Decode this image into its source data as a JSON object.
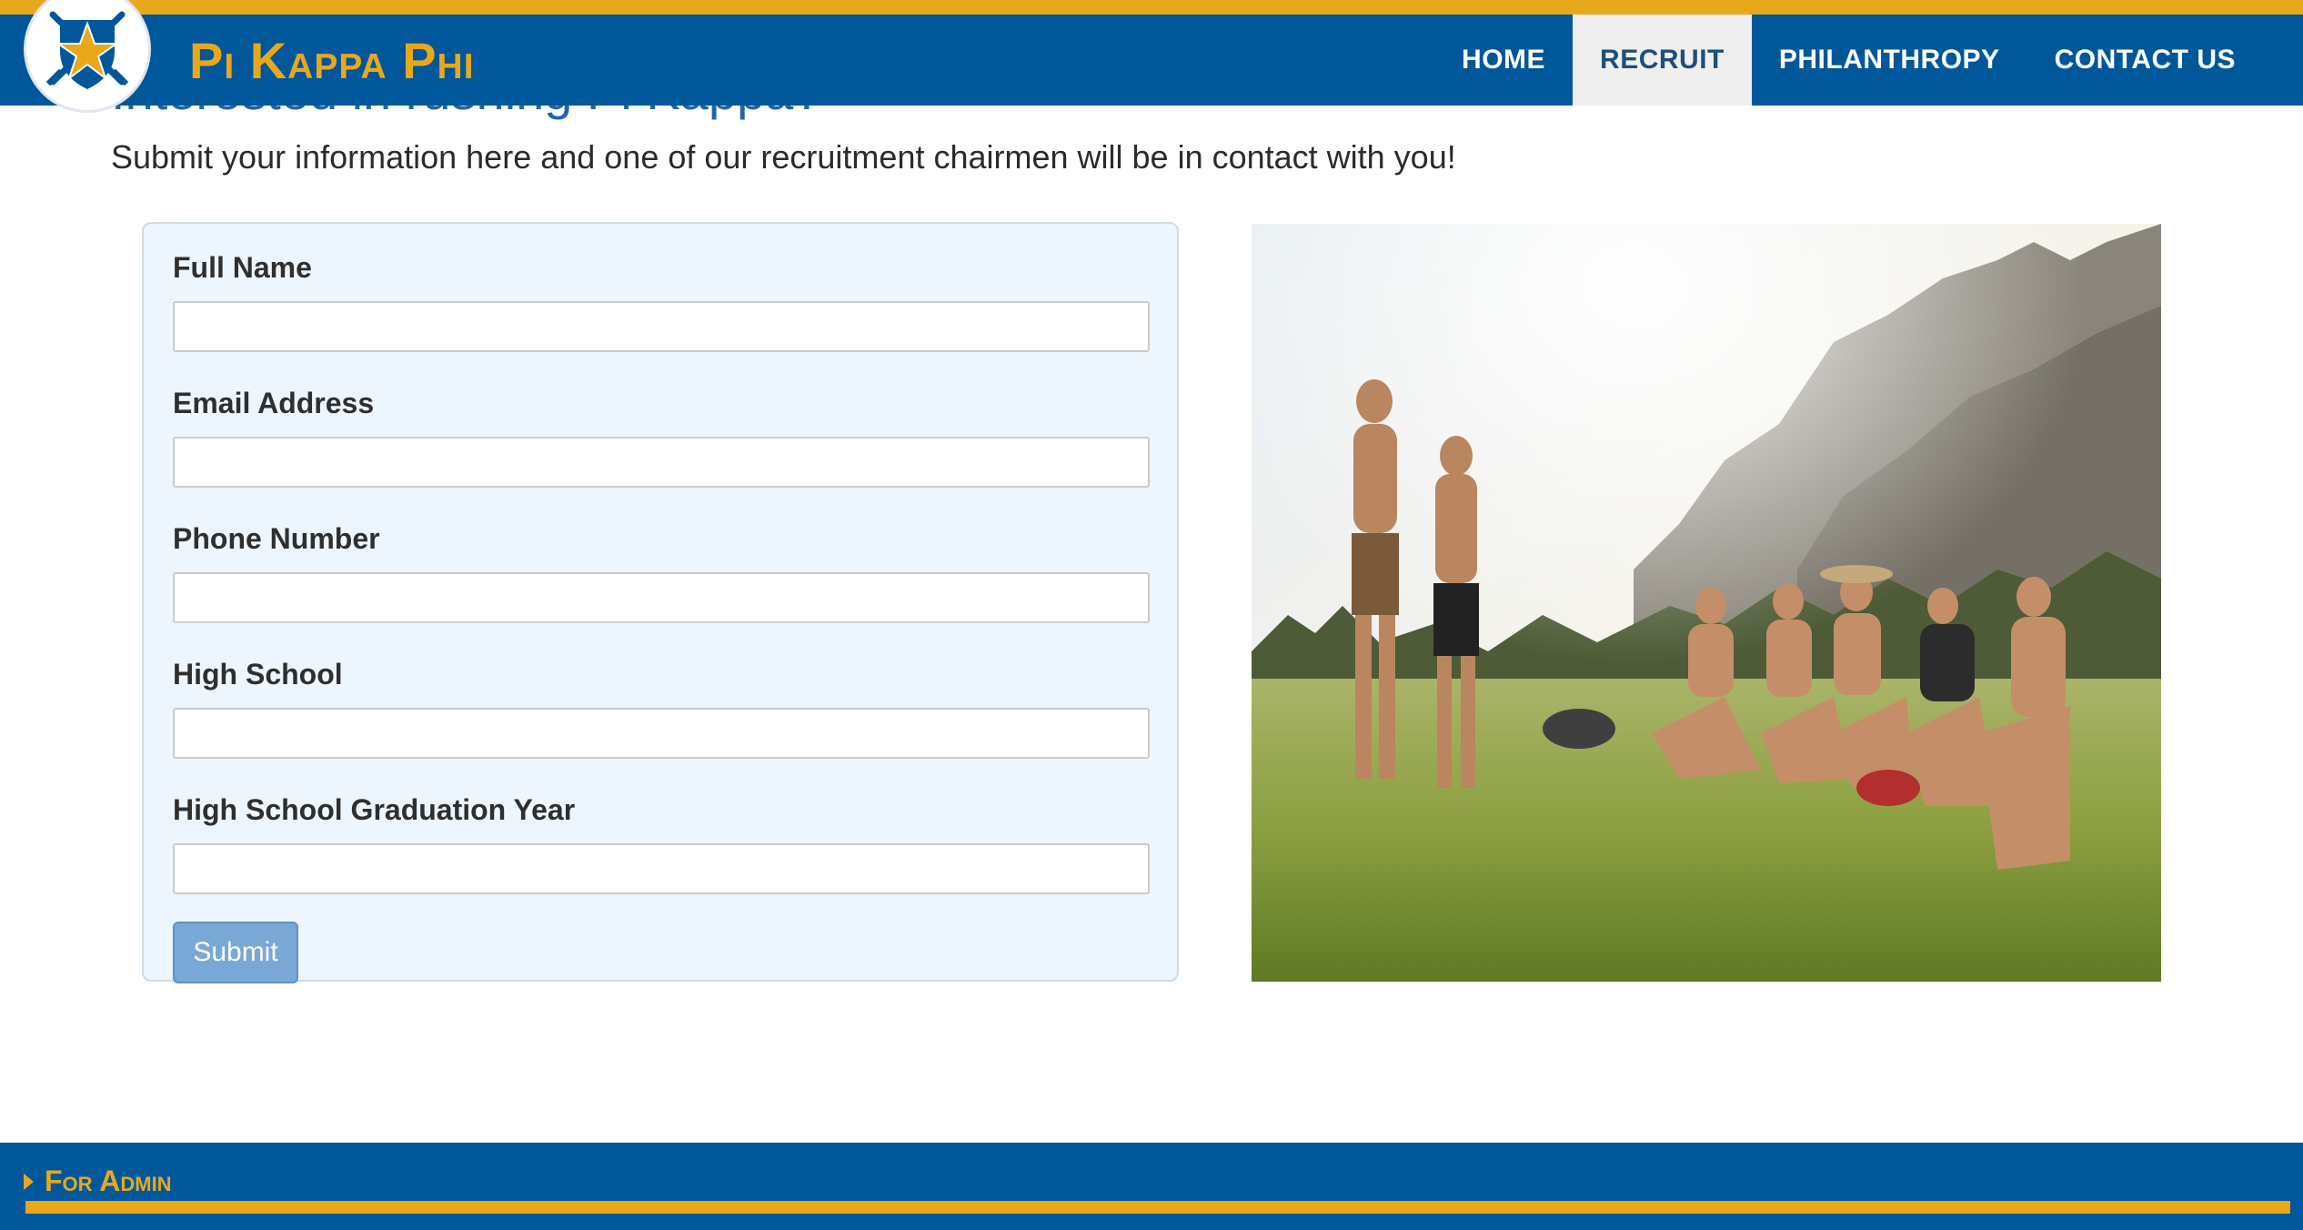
{
  "brand": {
    "name": "Pi Kappa Phi"
  },
  "nav": [
    {
      "label": "HOME"
    },
    {
      "label": "RECRUIT",
      "active": true
    },
    {
      "label": "PHILANTHROPY"
    },
    {
      "label": "CONTACT US"
    }
  ],
  "page": {
    "heading_partial": "Interested in rushing Pi Kappa?",
    "intro": "Submit your information here and one of our recruitment chairmen will be in contact with you!"
  },
  "form": {
    "fields": [
      {
        "label": "Full Name",
        "value": "",
        "placeholder": ""
      },
      {
        "label": "Email Address",
        "value": "",
        "placeholder": ""
      },
      {
        "label": "Phone Number",
        "value": "",
        "placeholder": ""
      },
      {
        "label": "High School",
        "value": "",
        "placeholder": ""
      },
      {
        "label": "High School Graduation Year",
        "value": "",
        "placeholder": ""
      }
    ],
    "submit_label": "Submit"
  },
  "footer": {
    "admin_label": "For Admin"
  },
  "colors": {
    "primary_blue": "#00579a",
    "gold": "#e8a81c",
    "form_bg": "#eef6fd",
    "submit_bg": "#7aa8d6"
  },
  "icons": {
    "logo": "star-crest-icon",
    "footer_toggle": "caret-right-icon"
  }
}
